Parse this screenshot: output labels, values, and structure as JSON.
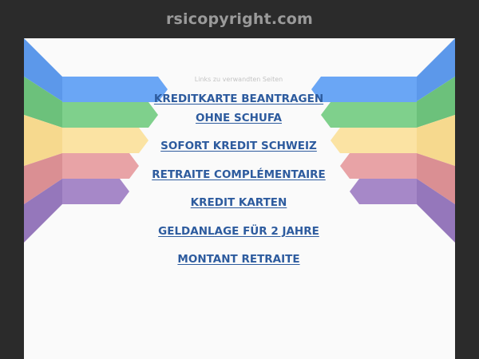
{
  "site": {
    "domain": "rsicopyright.com"
  },
  "related": {
    "header": "Links zu verwandten Seiten",
    "links": [
      {
        "label": "KREDITKARTE BEANTRAGEN OHNE SCHUFA"
      },
      {
        "label": "SOFORT KREDIT SCHWEIZ"
      },
      {
        "label": "RETRAITE COMPLÉMENTAIRE"
      },
      {
        "label": "KREDIT KARTEN"
      },
      {
        "label": "GELDANLAGE FÜR 2 JAHRE"
      },
      {
        "label": "MONTANT RETRAITE"
      }
    ]
  },
  "colors": {
    "background": "#2b2b2b",
    "panel": "#fafafa",
    "link": "#2d5b9e",
    "ribbon_blue": "#6aa6f5",
    "ribbon_green": "#7fd08c",
    "ribbon_yellow": "#fbe3a3",
    "ribbon_red": "#e8a3a6",
    "ribbon_purple": "#a688c8"
  }
}
